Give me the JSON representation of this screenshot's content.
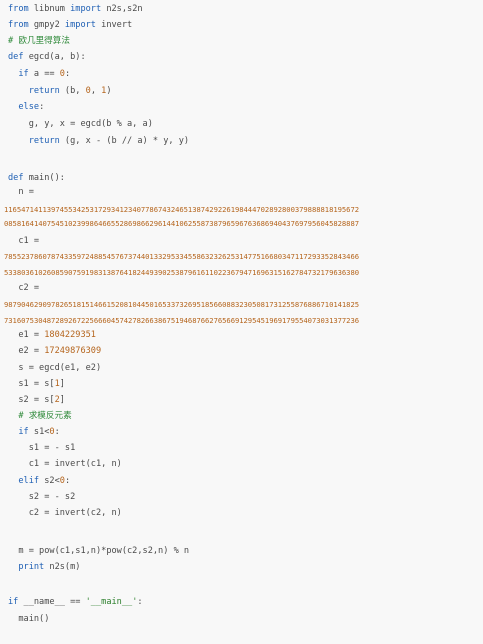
{
  "lines": [
    {
      "k1": "from",
      "t1": " libnum ",
      "k2": "import",
      "t2": " n2s,s2n"
    },
    {
      "k1": "from",
      "t1": " gmpy2 ",
      "k2": "import",
      "t2": " invert"
    },
    {
      "c": "# 欧几里得算法"
    },
    {
      "k1": "def",
      "t1": " egcd(a, b):"
    },
    {
      "i": "  ",
      "k1": "if",
      "t1": " a == ",
      "n": "0",
      "t2": ":"
    },
    {
      "i": "    ",
      "k1": "return",
      "t1": " (b, ",
      "n": "0",
      "t2": ", ",
      "n2": "1",
      "t3": ")"
    },
    {
      "i": "  ",
      "k1": "else",
      "t1": ":"
    },
    {
      "i": "    ",
      "t1": "g, y, x = egcd(b % a, a)"
    },
    {
      "i": "    ",
      "k1": "return",
      "t1": " (g, x - (b // a) * y, y)"
    },
    {
      "t1": ""
    },
    {
      "k1": "def",
      "t1": " main():"
    },
    {
      "i": "  ",
      "t1": "n ="
    },
    {
      "long": "11654714113974553425317293412340778674324651387429226198444702892800379888818195672"
    },
    {
      "long": "08581641407545102399864665528698662961441062558738796596763686940437697956045828887"
    },
    {
      "i": "  ",
      "t1": "c1 ="
    },
    {
      "long": "78552378607874335972488545767374401332953345586323262531477516680347117293352843466"
    },
    {
      "long": "53380361026085907591983138764182449390253879616110223679471696315162784732179636380"
    },
    {
      "i": "  ",
      "t1": "c2 ="
    },
    {
      "long": "98790462909782651815146615208104450165337326951856608832305081731255876886710141825"
    },
    {
      "long": "73160753048728926722566604574278266386751946876627656691295451969179554073031377236"
    },
    {
      "i": "  ",
      "t1": "e1 = ",
      "n": "1804229351"
    },
    {
      "i": "  ",
      "t1": "e2 = ",
      "n": "17249876309"
    },
    {
      "i": "  ",
      "t1": "s = egcd(e1, e2)"
    },
    {
      "i": "  ",
      "t1": "s1 = s[",
      "n": "1",
      "t2": "]"
    },
    {
      "i": "  ",
      "t1": "s2 = s[",
      "n": "2",
      "t2": "]"
    },
    {
      "i": "  ",
      "c": "# 求模反元素"
    },
    {
      "i": "  ",
      "k1": "if",
      "t1": " s1<",
      "n": "0",
      "t2": ":"
    },
    {
      "i": "    ",
      "t1": "s1 = - s1"
    },
    {
      "i": "    ",
      "t1": "c1 = invert(c1, n)"
    },
    {
      "i": "  ",
      "k1": "elif",
      "t1": " s2<",
      "n": "0",
      "t2": ":"
    },
    {
      "i": "    ",
      "t1": "s2 = - s2"
    },
    {
      "i": "    ",
      "t1": "c2 = invert(c2, n)"
    },
    {
      "t1": ""
    },
    {
      "i": "  ",
      "t1": "m = pow(c1,s1,n)*pow(c2,s2,n) % n"
    },
    {
      "i": "  ",
      "k1": "print",
      "t1": " n2s(m)"
    },
    {
      "t1": ""
    },
    {
      "k1": "if",
      "t1": " __name__ == ",
      "s": "'__main__'",
      "t2": ":"
    },
    {
      "i": "  ",
      "t1": "main()"
    }
  ]
}
